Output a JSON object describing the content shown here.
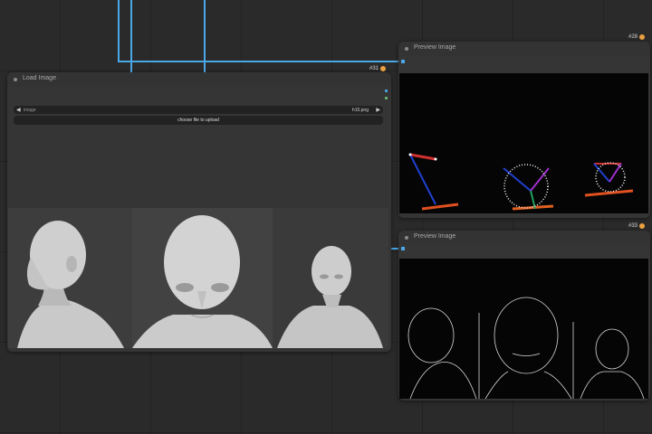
{
  "nodes": {
    "load_image": {
      "title": "Load Image",
      "id": "#31",
      "image_label": "image",
      "image_value": "h15.png",
      "upload_label": "choose file to upload"
    },
    "preview_top": {
      "title": "Preview Image",
      "id": "#28"
    },
    "preview_bottom": {
      "title": "Preview Image",
      "id": "#33"
    }
  },
  "colors": {
    "wire": "#4aa8e8",
    "canvas": "#2a2a2a",
    "node": "#353535"
  }
}
